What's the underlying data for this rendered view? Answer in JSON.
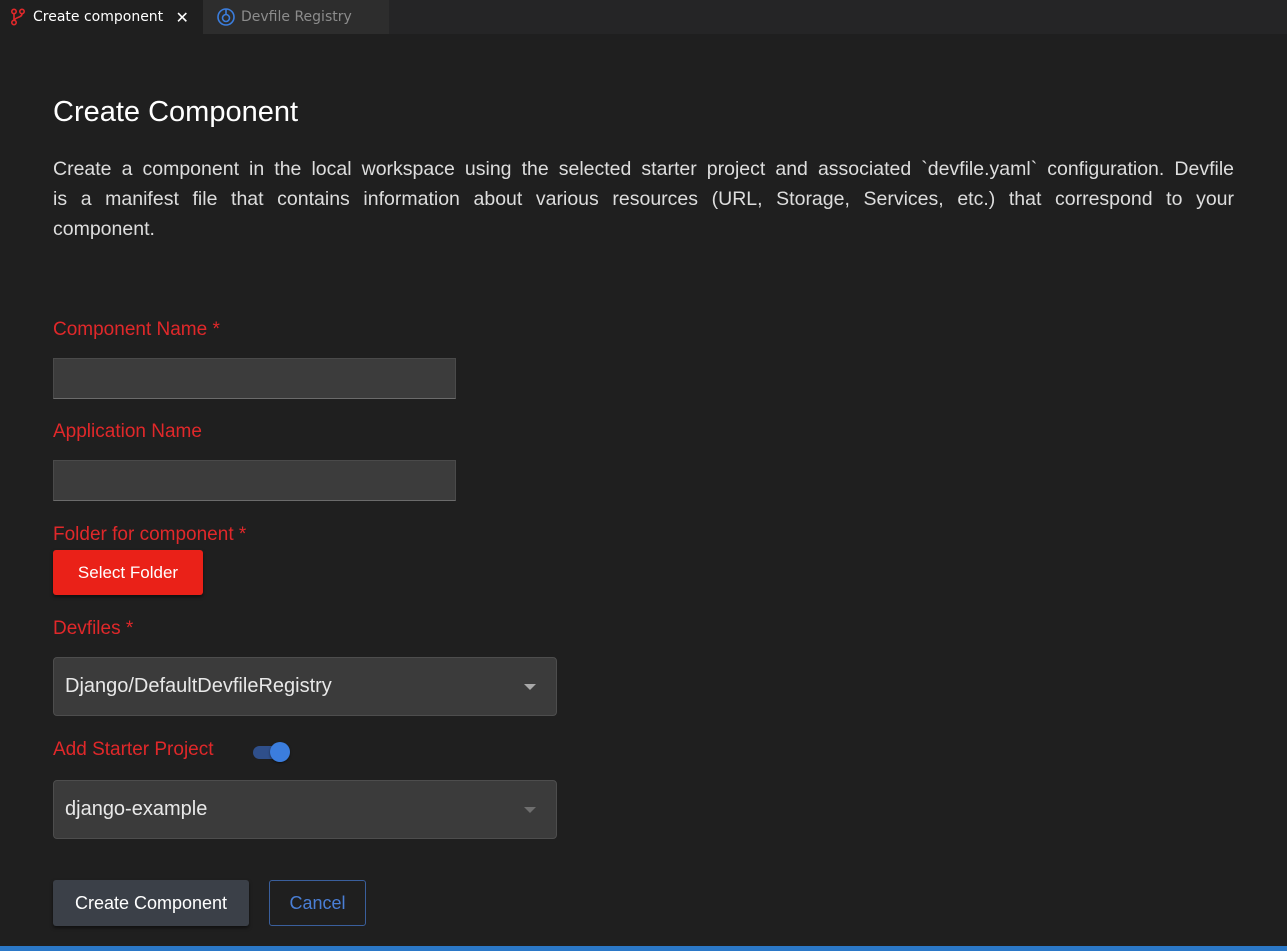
{
  "colors": {
    "accent_red": "#ea2118",
    "label_red": "#e0282a",
    "toggle_blue": "#3b7ddd",
    "statusbar_blue": "#2b78c7"
  },
  "tabs": [
    {
      "label": "Create component",
      "icon": "git-branch-icon",
      "active": true,
      "close_glyph": "✕"
    },
    {
      "label": "Devfile Registry",
      "icon": "registry-icon",
      "active": false
    }
  ],
  "page": {
    "title": "Create Component",
    "description": "Create a component in the local workspace using the selected starter project and associated `devfile.yaml` configuration. Devfile is a manifest file that contains information about various resources (URL, Storage, Services, etc.) that correspond to your component."
  },
  "form": {
    "component_name": {
      "label": "Component Name *",
      "value": ""
    },
    "application_name": {
      "label": "Application Name",
      "value": ""
    },
    "folder": {
      "label": "Folder for component *",
      "button_label": "Select Folder"
    },
    "devfiles": {
      "label": "Devfiles *",
      "selected": "Django/DefaultDevfileRegistry"
    },
    "starter_project": {
      "label": "Add Starter Project",
      "enabled": true,
      "selected": "django-example"
    }
  },
  "actions": {
    "create_label": "Create Component",
    "cancel_label": "Cancel"
  }
}
